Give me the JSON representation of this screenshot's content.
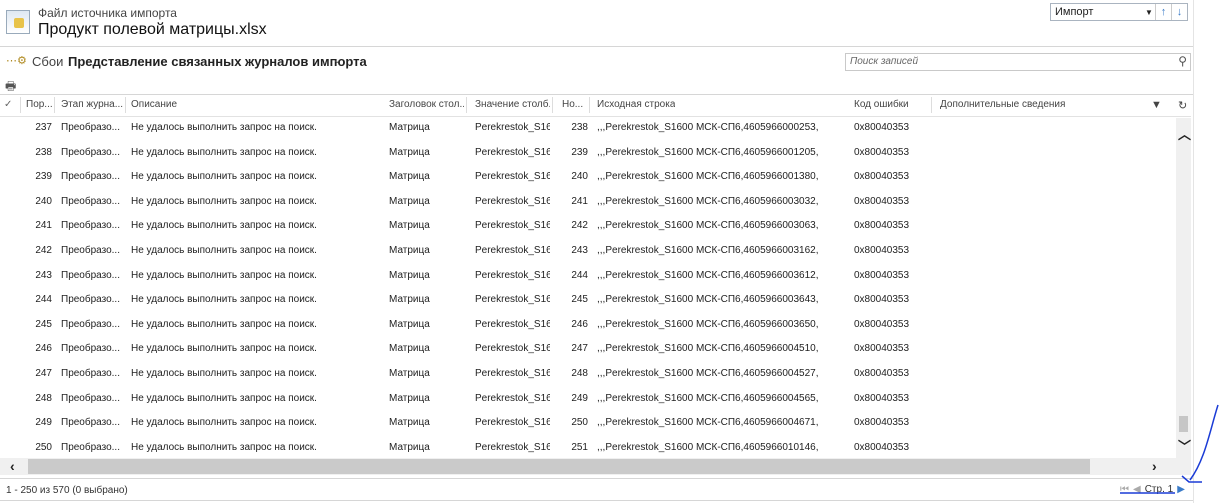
{
  "header": {
    "entity_label": "Файл источника импорта",
    "title": "Продукт полевой матрицы.xlsx",
    "nav_select": "Импорт"
  },
  "toolbar": {
    "fails_label": "Сбои",
    "view_name": "Представление связанных журналов импорта",
    "search_placeholder": "Поиск записей"
  },
  "columns": [
    "Пор...",
    "Этап журна...",
    "Описание",
    "Заголовок стол...",
    "Значение столб...",
    "Но...",
    "Исходная строка",
    "Код ошибки",
    "Дополнительные сведения"
  ],
  "rows": [
    [
      "237",
      "Преобразо...",
      "Не удалось выполнить запрос на поиск.",
      "Матрица",
      "Perekrestok_S16...",
      "238",
      ",,,Perekrestok_S1600 МСК-СП6,4605966000253,",
      "0x80040353"
    ],
    [
      "238",
      "Преобразо...",
      "Не удалось выполнить запрос на поиск.",
      "Матрица",
      "Perekrestok_S16...",
      "239",
      ",,,Perekrestok_S1600 МСК-СП6,4605966001205,",
      "0x80040353"
    ],
    [
      "239",
      "Преобразо...",
      "Не удалось выполнить запрос на поиск.",
      "Матрица",
      "Perekrestok_S16...",
      "240",
      ",,,Perekrestok_S1600 МСК-СП6,4605966001380,",
      "0x80040353"
    ],
    [
      "240",
      "Преобразо...",
      "Не удалось выполнить запрос на поиск.",
      "Матрица",
      "Perekrestok_S16...",
      "241",
      ",,,Perekrestok_S1600 МСК-СП6,4605966003032,",
      "0x80040353"
    ],
    [
      "241",
      "Преобразо...",
      "Не удалось выполнить запрос на поиск.",
      "Матрица",
      "Perekrestok_S16...",
      "242",
      ",,,Perekrestok_S1600 МСК-СП6,4605966003063,",
      "0x80040353"
    ],
    [
      "242",
      "Преобразо...",
      "Не удалось выполнить запрос на поиск.",
      "Матрица",
      "Perekrestok_S16...",
      "243",
      ",,,Perekrestok_S1600 МСК-СП6,4605966003162,",
      "0x80040353"
    ],
    [
      "243",
      "Преобразо...",
      "Не удалось выполнить запрос на поиск.",
      "Матрица",
      "Perekrestok_S16...",
      "244",
      ",,,Perekrestok_S1600 МСК-СП6,4605966003612,",
      "0x80040353"
    ],
    [
      "244",
      "Преобразо...",
      "Не удалось выполнить запрос на поиск.",
      "Матрица",
      "Perekrestok_S16...",
      "245",
      ",,,Perekrestok_S1600 МСК-СП6,4605966003643,",
      "0x80040353"
    ],
    [
      "245",
      "Преобразо...",
      "Не удалось выполнить запрос на поиск.",
      "Матрица",
      "Perekrestok_S16...",
      "246",
      ",,,Perekrestok_S1600 МСК-СП6,4605966003650,",
      "0x80040353"
    ],
    [
      "246",
      "Преобразо...",
      "Не удалось выполнить запрос на поиск.",
      "Матрица",
      "Perekrestok_S16...",
      "247",
      ",,,Perekrestok_S1600 МСК-СП6,4605966004510,",
      "0x80040353"
    ],
    [
      "247",
      "Преобразо...",
      "Не удалось выполнить запрос на поиск.",
      "Матрица",
      "Perekrestok_S16...",
      "248",
      ",,,Perekrestok_S1600 МСК-СП6,4605966004527,",
      "0x80040353"
    ],
    [
      "248",
      "Преобразо...",
      "Не удалось выполнить запрос на поиск.",
      "Матрица",
      "Perekrestok_S16...",
      "249",
      ",,,Perekrestok_S1600 МСК-СП6,4605966004565,",
      "0x80040353"
    ],
    [
      "249",
      "Преобразо...",
      "Не удалось выполнить запрос на поиск.",
      "Матрица",
      "Perekrestok_S16...",
      "250",
      ",,,Perekrestok_S1600 МСК-СП6,4605966004671,",
      "0x80040353"
    ],
    [
      "250",
      "Преобразо...",
      "Не удалось выполнить запрос на поиск.",
      "Матрица",
      "Perekrestok_S16...",
      "251",
      ",,,Perekrestok_S1600 МСК-СП6,4605966010146,",
      "0x80040353"
    ]
  ],
  "footer": {
    "record_count": "1 - 250 из 570 (0 выбрано)",
    "page_label": "Стр. 1"
  },
  "colors": {
    "accent": "#3a7bc8",
    "annotation": "#1a3bd6"
  }
}
